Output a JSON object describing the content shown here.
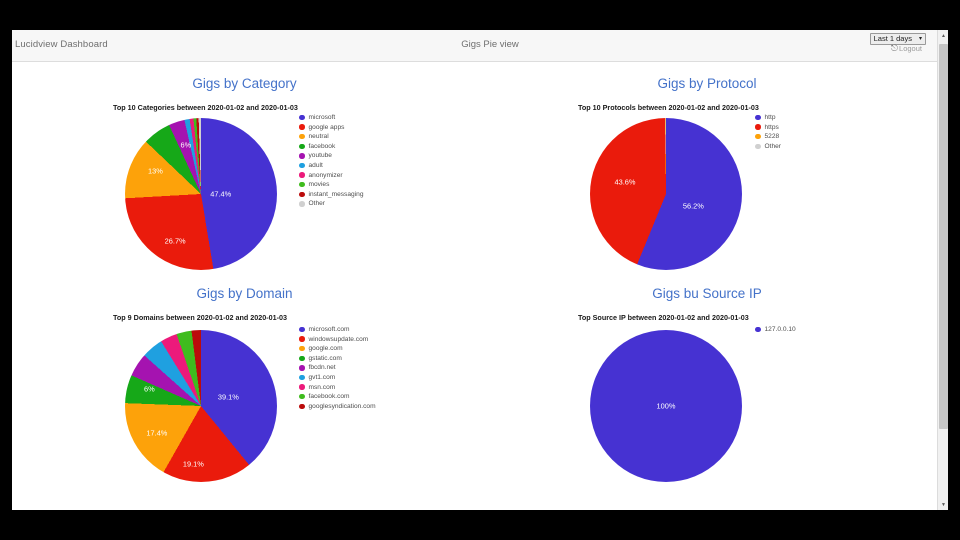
{
  "window": {
    "brand": "Lucidview Dashboard",
    "page_title": "Gigs Pie view",
    "range_label": "Last 1 days",
    "range_caret": "▾",
    "logout_label": "Logout",
    "logout_icon": "logout-icon",
    "scroll_up_icon": "▲",
    "scroll_down_icon": "▼"
  },
  "palette": {
    "title_blue": "#4472c9",
    "slice_blue": "#4632d2",
    "slice_red": "#ea1b0c",
    "slice_orange": "#fda20a",
    "slice_green": "#16a818",
    "slice_purple": "#a513b0",
    "slice_cyan": "#1fa0e0",
    "slice_pink": "#ec1a7b",
    "slice_lightgreen": "#3fbc1e",
    "slice_darkred": "#bb0b0b",
    "slice_gray": "#d0d0d0"
  },
  "chart_data": [
    {
      "id": "gigs-by-category",
      "type": "pie",
      "title": "Gigs by Category",
      "subtitle": "Top 10 Categories between 2020-01-02 and 2020-01-03",
      "legend_position": "right",
      "categories": [
        "microsoft",
        "google apps",
        "neutral",
        "facebook",
        "youtube",
        "adult",
        "anonymizer",
        "movies",
        "instant_messaging",
        "Other"
      ],
      "values": [
        47.4,
        26.7,
        13.0,
        6.0,
        3.4,
        1.1,
        0.8,
        0.6,
        0.5,
        0.5
      ],
      "colors": [
        "#4632d2",
        "#ea1b0c",
        "#fda20a",
        "#16a818",
        "#a513b0",
        "#1fa0e0",
        "#ec1a7b",
        "#3fbc1e",
        "#bb0b0b",
        "#d0d0d0"
      ],
      "visible_labels": [
        {
          "text": "47.4%",
          "x": 63,
          "y": 50
        },
        {
          "text": "26.7%",
          "x": 33,
          "y": 81
        },
        {
          "text": "13%",
          "x": 20,
          "y": 35
        },
        {
          "text": "6%",
          "x": 40,
          "y": 18
        }
      ]
    },
    {
      "id": "gigs-by-protocol",
      "type": "pie",
      "title": "Gigs by Protocol",
      "subtitle": "Top 10 Protocols between 2020-01-02 and 2020-01-03",
      "legend_position": "right",
      "categories": [
        "http",
        "https",
        "5228",
        "Other"
      ],
      "values": [
        56.2,
        43.6,
        0.1,
        0.1
      ],
      "colors": [
        "#4632d2",
        "#ea1b0c",
        "#fda20a",
        "#d0d0d0"
      ],
      "visible_labels": [
        {
          "text": "56.2%",
          "x": 68,
          "y": 58
        },
        {
          "text": "43.6%",
          "x": 23,
          "y": 42
        }
      ]
    },
    {
      "id": "gigs-by-domain",
      "type": "pie",
      "title": "Gigs by Domain",
      "subtitle": "Top 9 Domains between 2020-01-02 and 2020-01-03",
      "legend_position": "right",
      "categories": [
        "microsoft.com",
        "windowsupdate.com",
        "google.com",
        "gstatic.com",
        "fbcdn.net",
        "gvt1.com",
        "msn.com",
        "facebook.com",
        "googlesyndication.com"
      ],
      "values": [
        39.1,
        19.1,
        17.4,
        6.0,
        5.0,
        4.6,
        3.6,
        3.2,
        2.0
      ],
      "colors": [
        "#4632d2",
        "#ea1b0c",
        "#fda20a",
        "#16a818",
        "#a513b0",
        "#1fa0e0",
        "#ec1a7b",
        "#3fbc1e",
        "#bb0b0b"
      ],
      "visible_labels": [
        {
          "text": "39.1%",
          "x": 68,
          "y": 44
        },
        {
          "text": "19.1%",
          "x": 45,
          "y": 88
        },
        {
          "text": "17.4%",
          "x": 21,
          "y": 68
        },
        {
          "text": "6%",
          "x": 16,
          "y": 39
        }
      ]
    },
    {
      "id": "gigs-by-source-ip",
      "type": "pie",
      "title": "Gigs bu Source IP",
      "subtitle": "Top Source IP between 2020-01-02 and 2020-01-03",
      "legend_position": "right",
      "categories": [
        "127.0.0.10"
      ],
      "values": [
        100
      ],
      "colors": [
        "#4632d2"
      ],
      "visible_labels": [
        {
          "text": "100%",
          "x": 50,
          "y": 50
        }
      ]
    }
  ]
}
